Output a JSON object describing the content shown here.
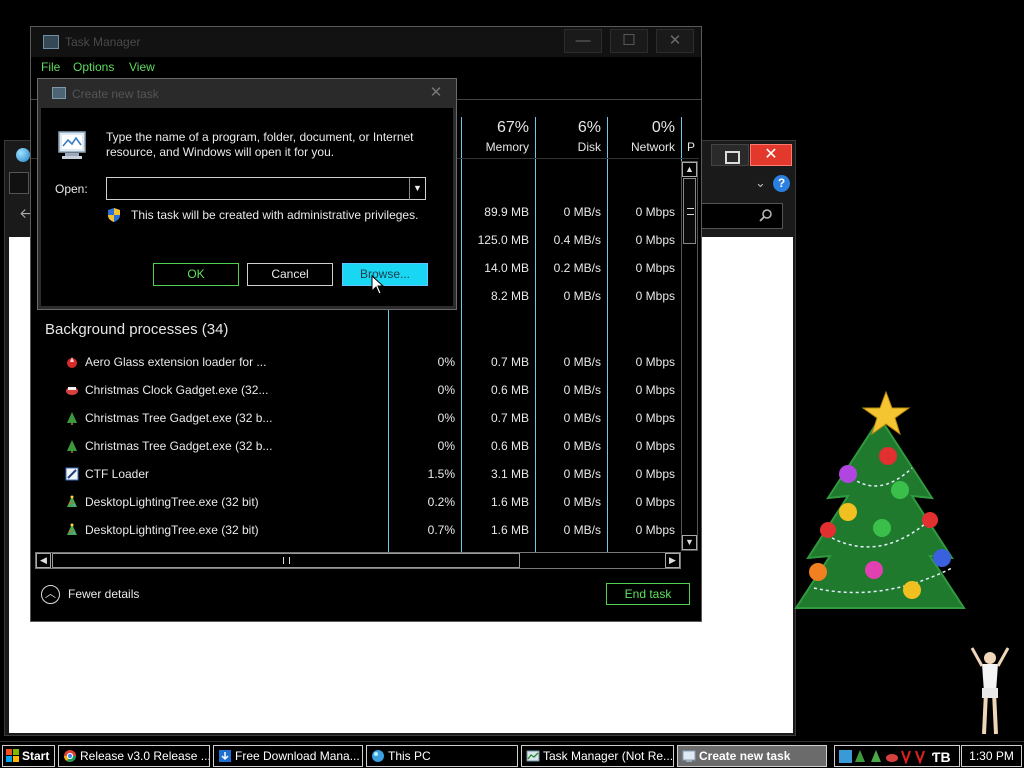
{
  "explorer": {
    "close_glyph": "✕"
  },
  "taskmgr": {
    "title": "Task Manager",
    "minimize_glyph": "—",
    "maximize_glyph": "☐",
    "close_glyph": "✕",
    "menu": [
      "File",
      "Options",
      "View"
    ],
    "columns": [
      {
        "pct": "67%",
        "label": "Memory"
      },
      {
        "pct": "6%",
        "label": "Disk"
      },
      {
        "pct": "0%",
        "label": "Network"
      },
      {
        "pct": "",
        "label": "P"
      }
    ],
    "app_rows": [
      {
        "memory": "89.9 MB",
        "disk": "0 MB/s",
        "network": "0 Mbps"
      },
      {
        "memory": "125.0 MB",
        "disk": "0.4 MB/s",
        "network": "0 Mbps"
      },
      {
        "memory": "14.0 MB",
        "disk": "0.2 MB/s",
        "network": "0 Mbps"
      },
      {
        "memory": "8.2 MB",
        "disk": "0 MB/s",
        "network": "0 Mbps"
      }
    ],
    "background_title": "Background processes (34)",
    "bg_rows": [
      {
        "name": "Aero Glass extension loader for ...",
        "icon": "aero-glass-icon",
        "cpu": "0%",
        "memory": "0.7 MB",
        "disk": "0 MB/s",
        "network": "0 Mbps"
      },
      {
        "name": "Christmas Clock Gadget.exe (32...",
        "icon": "christmas-clock-icon",
        "cpu": "0%",
        "memory": "0.6 MB",
        "disk": "0 MB/s",
        "network": "0 Mbps"
      },
      {
        "name": "Christmas Tree Gadget.exe (32 b...",
        "icon": "christmas-tree-icon",
        "cpu": "0%",
        "memory": "0.7 MB",
        "disk": "0 MB/s",
        "network": "0 Mbps"
      },
      {
        "name": "Christmas Tree Gadget.exe (32 b...",
        "icon": "christmas-tree-icon",
        "cpu": "0%",
        "memory": "0.6 MB",
        "disk": "0 MB/s",
        "network": "0 Mbps"
      },
      {
        "name": "CTF Loader",
        "icon": "ctf-loader-icon",
        "cpu": "1.5%",
        "memory": "3.1 MB",
        "disk": "0 MB/s",
        "network": "0 Mbps"
      },
      {
        "name": "DesktopLightingTree.exe (32 bit)",
        "icon": "lighting-tree-icon",
        "cpu": "0.2%",
        "memory": "1.6 MB",
        "disk": "0 MB/s",
        "network": "0 Mbps"
      },
      {
        "name": "DesktopLightingTree.exe (32 bit)",
        "icon": "lighting-tree-icon",
        "cpu": "0.7%",
        "memory": "1.6 MB",
        "disk": "0 MB/s",
        "network": "0 Mbps"
      }
    ],
    "fewer_details": "Fewer details",
    "end_task": "End task"
  },
  "dialog": {
    "title": "Create new task",
    "close_glyph": "✕",
    "instructions": "Type the name of a program, folder, document, or Internet resource, and Windows will open it for you.",
    "open_label": "Open:",
    "open_value": "",
    "admin_note": "This task will be created with administrative privileges.",
    "ok": "OK",
    "cancel": "Cancel",
    "browse": "Browse..."
  },
  "taskbar": {
    "start": "Start",
    "items": [
      {
        "label": "Release v3.0 Release ...",
        "icon": "chrome-icon"
      },
      {
        "label": "Free Download Mana...",
        "icon": "download-manager-icon"
      },
      {
        "label": "This PC",
        "icon": "this-pc-icon"
      },
      {
        "label": "Task Manager (Not Re...",
        "icon": "task-manager-icon"
      },
      {
        "label": "Create new task",
        "icon": "run-dialog-icon"
      }
    ],
    "clock": "1:30 PM"
  },
  "colors": {
    "accent_green": "#5fe15f",
    "column_separator": "#6fc8ec",
    "browse_button": "#19d6f2",
    "close_red": "#e3392d"
  }
}
